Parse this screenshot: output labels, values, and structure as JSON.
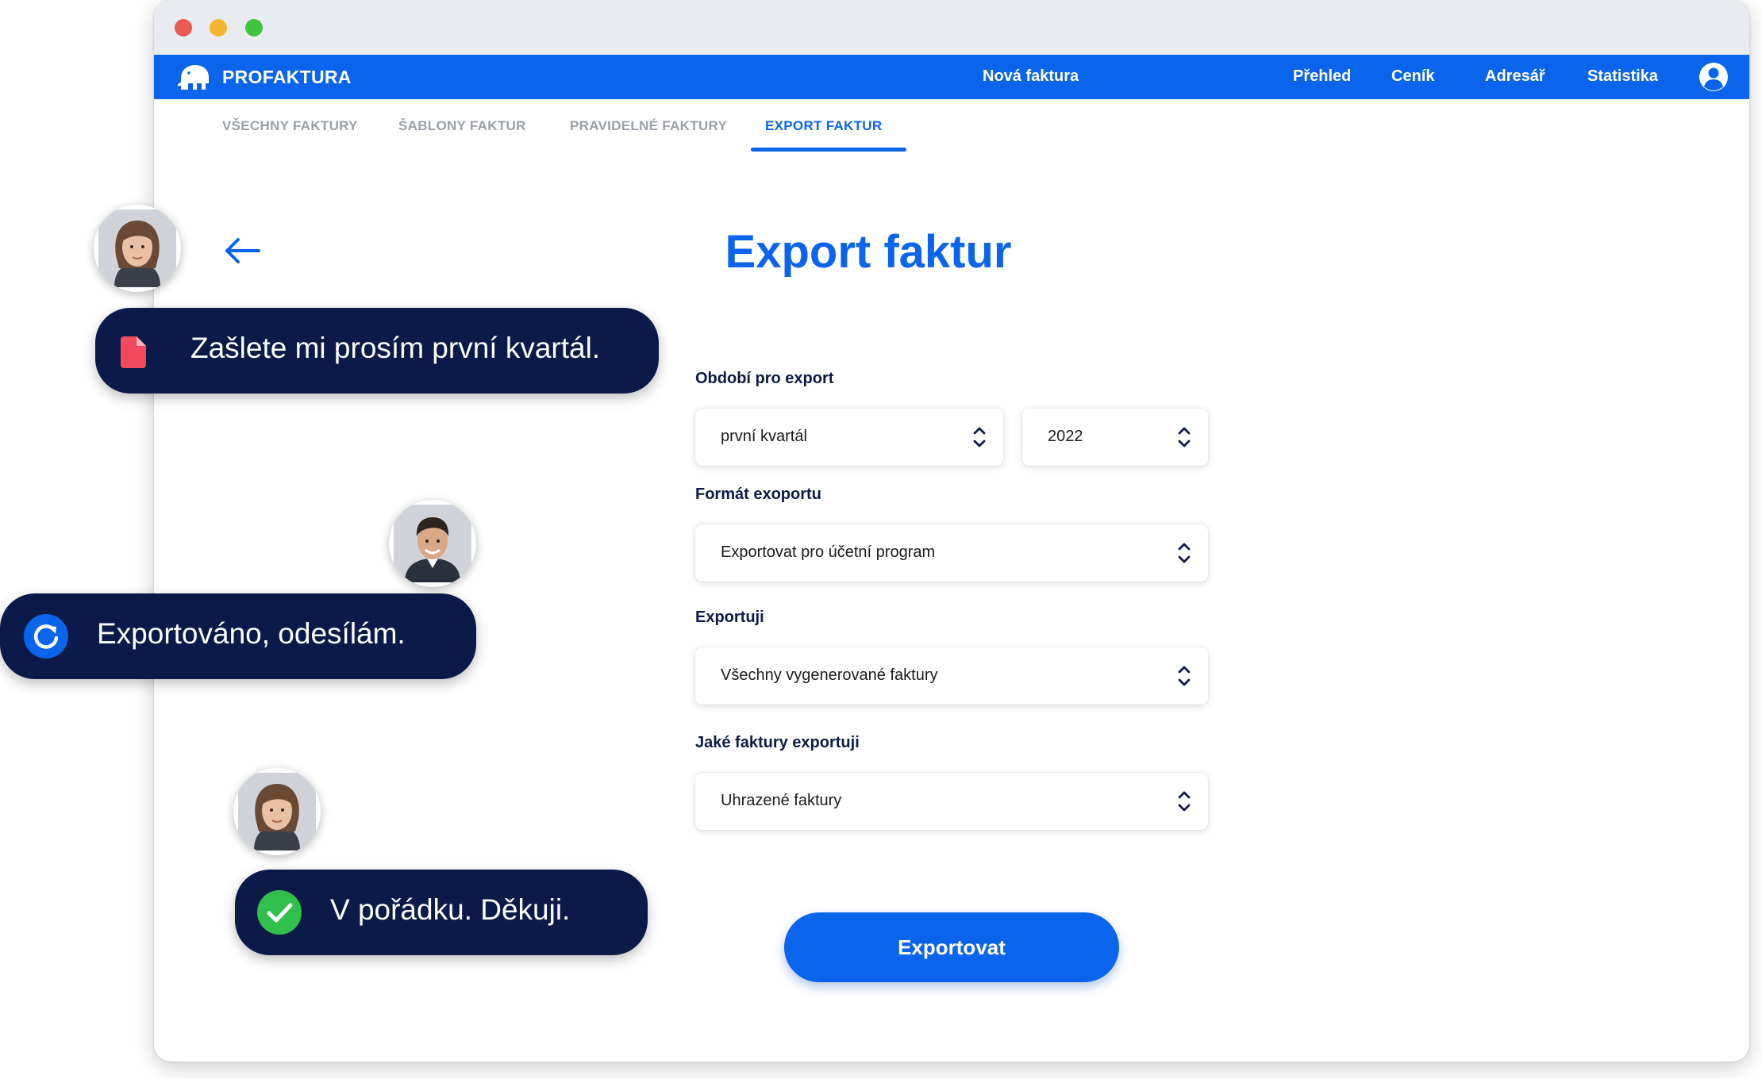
{
  "app": {
    "brand_name": "PROFAKTURA",
    "accent_color": "#0a64ec",
    "dark_color": "#0b1a48"
  },
  "nav": {
    "links": [
      "Nová faktura",
      "Přehled",
      "Ceník",
      "Adresář",
      "Statistika"
    ],
    "user_icon": "user-circle-icon"
  },
  "tabs": {
    "items": [
      "VŠECHNY FAKTURY",
      "ŠABLONY FAKTUR",
      "PRAVIDELNÉ FAKTURY",
      "EXPORT FAKTUR"
    ],
    "active": "EXPORT FAKTUR"
  },
  "page": {
    "title": "Export faktur",
    "back_icon": "arrow-left-icon"
  },
  "form": {
    "period_label": "Období pro export",
    "period_value": "první kvartál",
    "year_value": "2022",
    "format_label": "Formát exoportu",
    "format_value": "Exportovat pro účetní program",
    "scope_label": "Exportuji",
    "scope_value": "Všechny vygenerované faktury",
    "type_label": "Jaké faktury exportuji",
    "type_value": "Uhrazené faktury",
    "submit_label": "Exportovat"
  },
  "chat": [
    {
      "text": "Zašlete mi prosím první kvartál.",
      "icon": "document-icon",
      "icon_color": "#f2495e"
    },
    {
      "text": "Exportováno, odesílám.",
      "icon": "refresh-icon",
      "icon_color": "#0a64ec"
    },
    {
      "text": "V pořádku. Děkuji.",
      "icon": "check-circle-icon",
      "icon_color": "#2fbf4a"
    }
  ]
}
